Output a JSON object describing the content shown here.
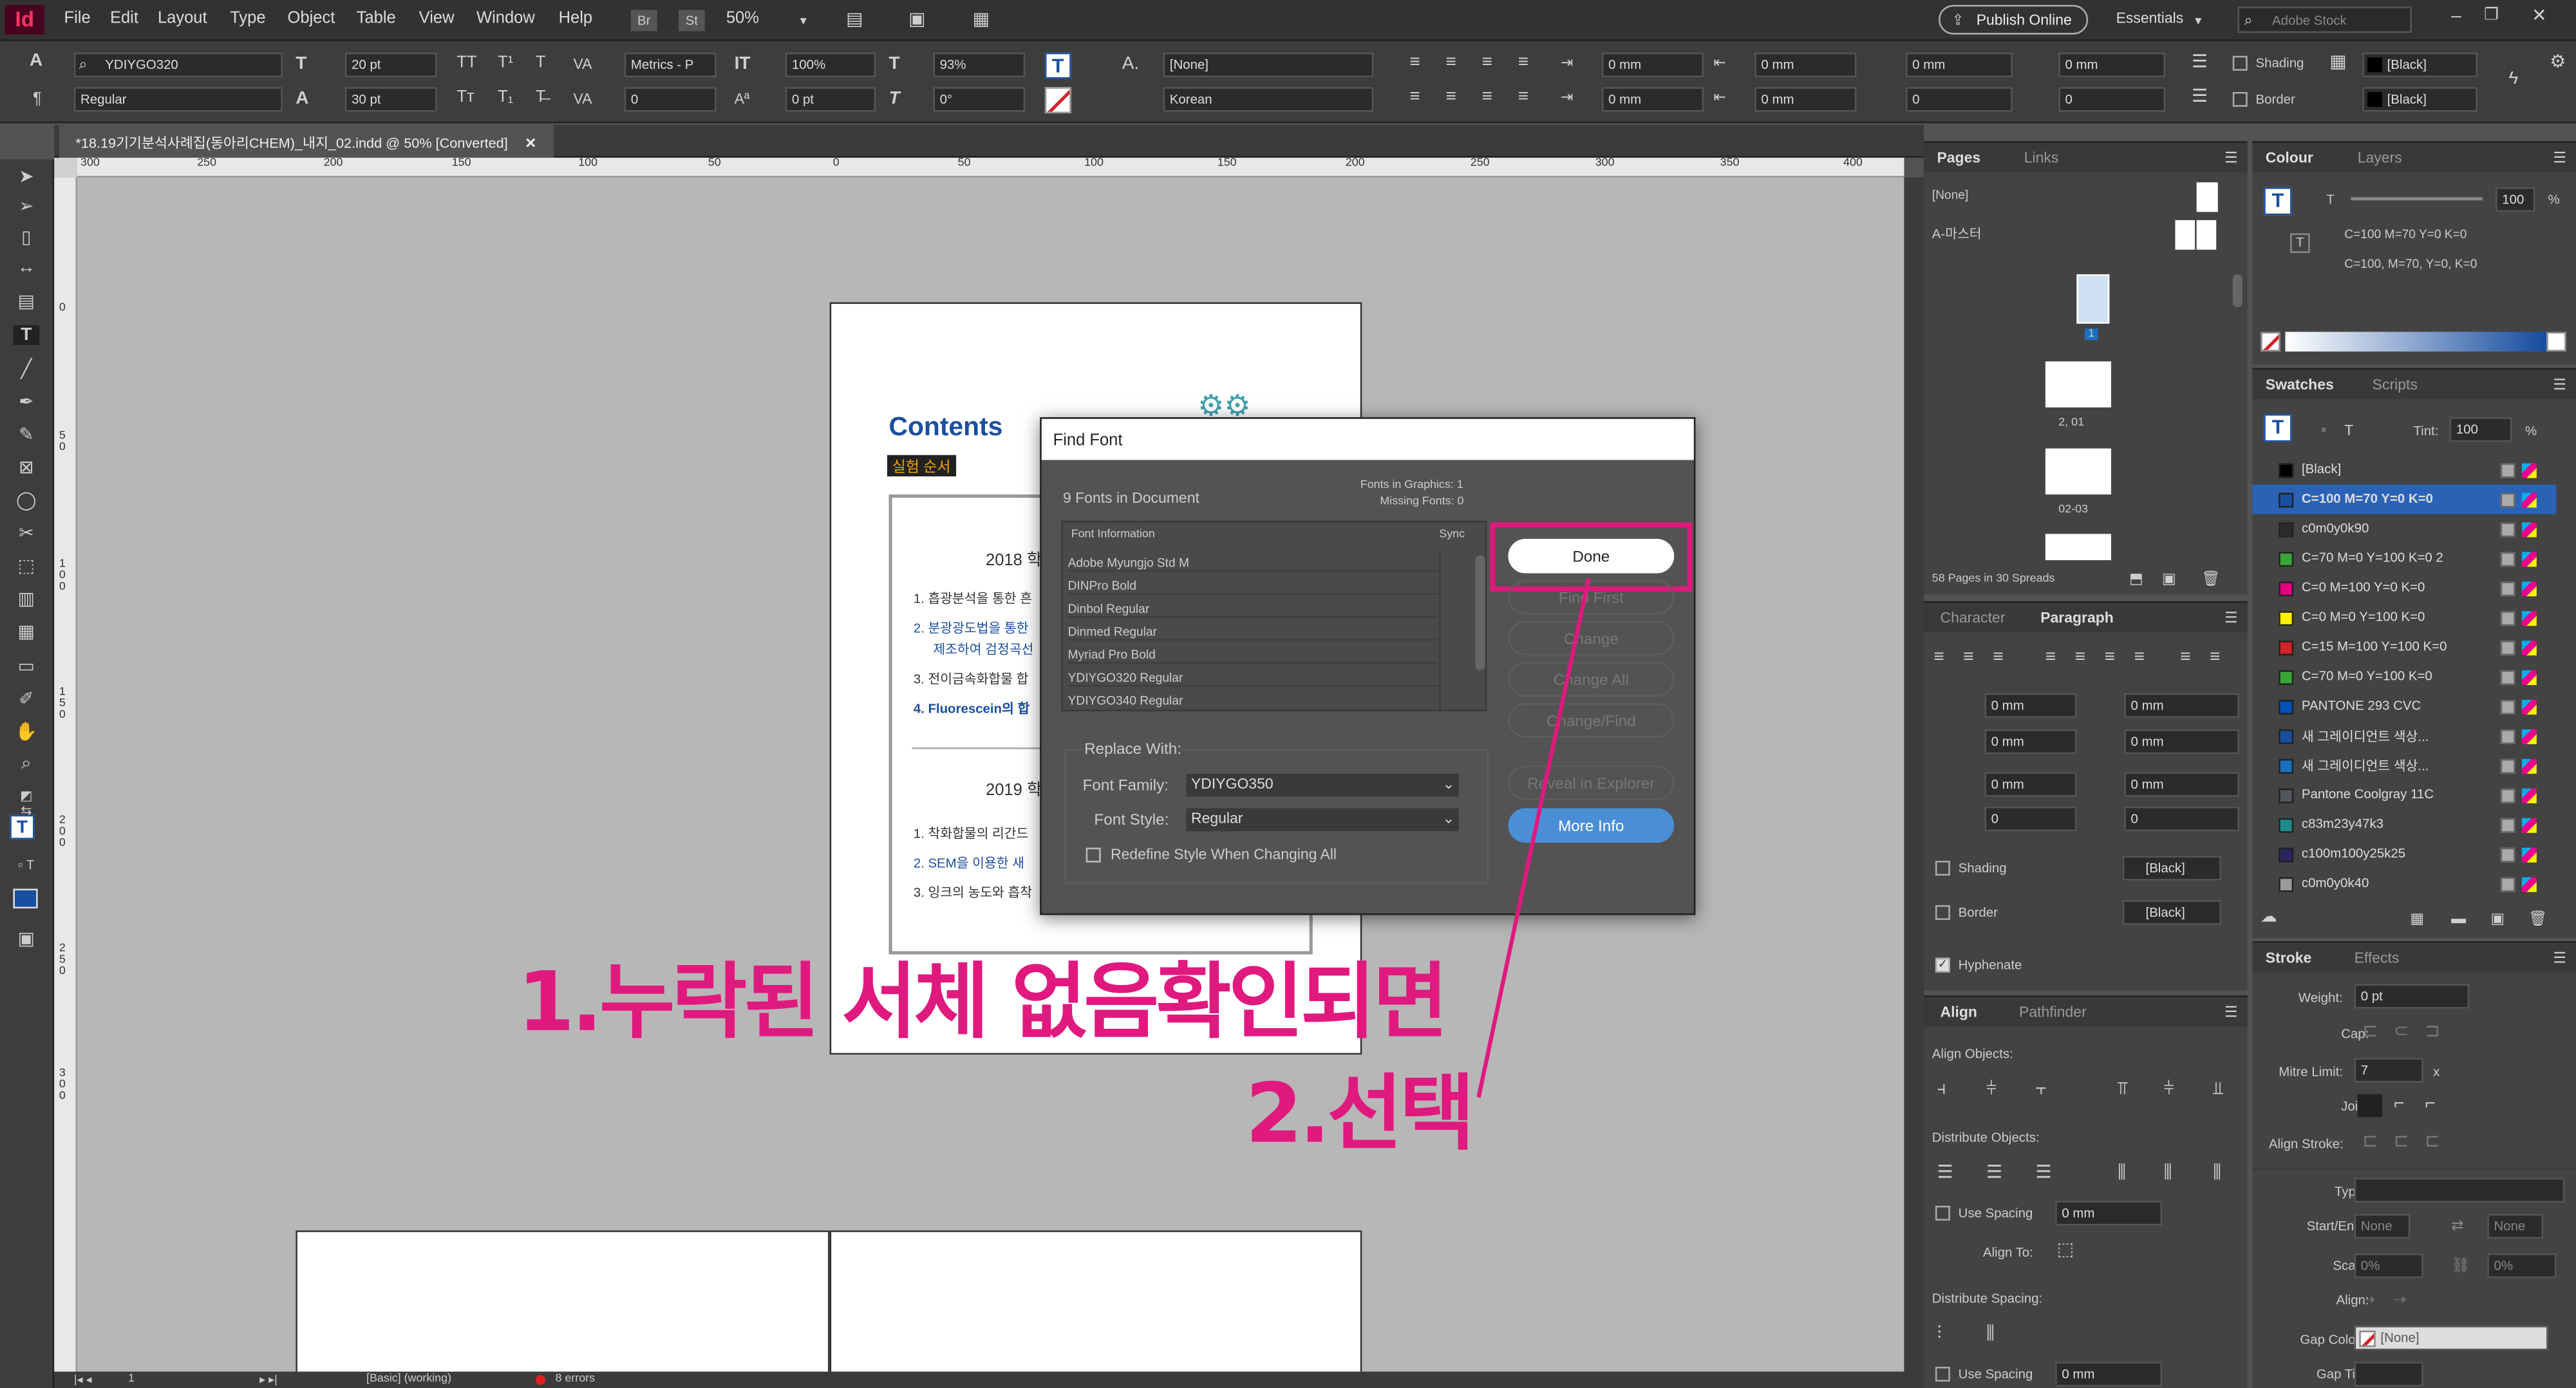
{
  "app": {
    "logo": "Id"
  },
  "menu": [
    "File",
    "Edit",
    "Layout",
    "Type",
    "Object",
    "Table",
    "View",
    "Window",
    "Help"
  ],
  "menubar": {
    "br": "Br",
    "st": "St",
    "zoom": "50%",
    "publish": "Publish Online",
    "workspace": "Essentials",
    "stock_placeholder": "Adobe Stock"
  },
  "control": {
    "font_family": "YDIYGO320",
    "font_style": "Regular",
    "font_size": "20 pt",
    "leading": "30 pt",
    "kerning": "Metrics - P",
    "tracking": "0",
    "vscale": "100%",
    "baseline": "0 pt",
    "hscale": "93%",
    "skew": "0°",
    "char_style": "[None]",
    "language": "Korean",
    "indent_left": "0 mm",
    "indent_first": "0 mm",
    "indent_right": "0 mm",
    "indent_last": "0 mm",
    "space_before": "0 mm",
    "space_after": "0 mm",
    "drop_lines": "0",
    "drop_chars": "0",
    "shading": "Shading",
    "border": "Border",
    "swatch": "[Black]"
  },
  "doc_tab": "*18.19기기분석사례집(동아리CHEM)_내지_02.indd @ 50% [Converted]",
  "ruler_h": [
    "300",
    "250",
    "200",
    "150",
    "100",
    "50",
    "0",
    "50",
    "100",
    "150",
    "200",
    "250",
    "300",
    "350",
    "400"
  ],
  "ruler_v": [
    "0",
    "5\n0",
    "1\n0\n0",
    "1\n5\n0",
    "2\n0\n0",
    "2\n5\n0",
    "3\n0\n0"
  ],
  "page_content": {
    "title": "Contents",
    "tag": "실험 순서",
    "h2018": "2018 학",
    "items2018": [
      "1. 흡광분석을 통한 흔",
      "2. 분광광도법을 통한",
      "제조하여 검정곡선",
      "3. 전이금속화합물 합",
      "4. Fluorescein의 합"
    ],
    "h2019": "2019 학",
    "items2019": [
      "1. 착화합물의 리간드",
      "2. SEM을 이용한 새",
      "3. 잉크의 농도와 흡착"
    ]
  },
  "dialog": {
    "title": "Find Font",
    "fonts_count": "9 Fonts in Document",
    "fonts_in_graphics": "Fonts in Graphics: 1",
    "missing_fonts": "Missing Fonts: 0",
    "col_font": "Font Information",
    "col_sync": "Sync",
    "fonts": [
      "Adobe Myungjo Std M",
      "DINPro Bold",
      "Dinbol Regular",
      "Dinmed Regular",
      "Myriad Pro Bold",
      "YDIYGO320 Regular",
      "YDIYGO340 Regular"
    ],
    "btn_done": "Done",
    "btn_find_first": "Find First",
    "btn_change": "Change",
    "btn_change_all": "Change All",
    "btn_change_find": "Change/Find",
    "btn_reveal": "Reveal in Explorer",
    "btn_more": "More Info",
    "replace_with": "Replace With:",
    "family_label": "Font Family:",
    "family_value": "YDIYGO350",
    "style_label": "Font Style:",
    "style_value": "Regular",
    "redefine": "Redefine Style When Changing All"
  },
  "annotation": {
    "line1": "1.누락된 서체 없음확인되면",
    "line2": "2.선택"
  },
  "status": {
    "page": "1",
    "preflight": "[Basic] (working)",
    "errors": "8 errors"
  },
  "pages_panel": {
    "tab_pages": "Pages",
    "tab_links": "Links",
    "none": "[None]",
    "master": "A-마스터",
    "p1": "1",
    "p2": "2, 01",
    "p3": "02-03",
    "summary": "58 Pages in 30 Spreads"
  },
  "colour_panel": {
    "tab_colour": "Colour",
    "tab_layers": "Layers",
    "t": "T",
    "pct": "100",
    "pct_sign": "%",
    "cmyk1": "C=100 M=70 Y=0 K=0",
    "cmyk2": "C=100, M=70, Y=0, K=0"
  },
  "swatches_panel": {
    "tab_swatches": "Swatches",
    "tab_scripts": "Scripts",
    "tint_label": "Tint:",
    "tint": "100",
    "pct": "%",
    "items": [
      {
        "name": "[Black]",
        "color": "#000000"
      },
      {
        "name": "C=100 M=70 Y=0 K=0",
        "color": "#1a4fa0"
      },
      {
        "name": "c0m0y0k90",
        "color": "#2b2b2b"
      },
      {
        "name": "C=70 M=0 Y=100 K=0 2",
        "color": "#3aa639"
      },
      {
        "name": "C=0 M=100 Y=0 K=0",
        "color": "#e6007e"
      },
      {
        "name": "C=0 M=0 Y=100 K=0",
        "color": "#fff100"
      },
      {
        "name": "C=15 M=100 Y=100 K=0",
        "color": "#d2232a"
      },
      {
        "name": "C=70 M=0 Y=100 K=0",
        "color": "#3aa639"
      },
      {
        "name": "PANTONE 293 CVC",
        "color": "#0051ba"
      },
      {
        "name": "새 그레이디언트 색상...",
        "color": "#1a4fa0"
      },
      {
        "name": "새 그레이디언트 색상...",
        "color": "#1a6fc0"
      },
      {
        "name": "Pantone Coolgray 11C",
        "color": "#53565a"
      },
      {
        "name": "c83m23y47k3",
        "color": "#1e8b8a"
      },
      {
        "name": "c100m100y25k25",
        "color": "#2a2460"
      },
      {
        "name": "c0m0y0k40",
        "color": "#999999"
      }
    ]
  },
  "paragraph_panel": {
    "tab_character": "Character",
    "tab_paragraph": "Paragraph",
    "mm": "0 mm",
    "zero": "0",
    "shading": "Shading",
    "border": "Border",
    "black": "[Black]",
    "hyphenate": "Hyphenate"
  },
  "align_panel": {
    "tab_align": "Align",
    "tab_pathfinder": "Pathfinder",
    "align_objects": "Align Objects:",
    "distribute_objects": "Distribute Objects:",
    "use_spacing": "Use Spacing",
    "mm": "0 mm",
    "align_to": "Align To:",
    "distribute_spacing": "Distribute Spacing:"
  },
  "stroke_panel": {
    "tab_stroke": "Stroke",
    "tab_effects": "Effects",
    "weight": "Weight:",
    "weight_val": "0 pt",
    "cap": "Cap:",
    "mitre": "Mitre Limit:",
    "mitre_val": "7",
    "x": "x",
    "join": "Join:",
    "align_stroke": "Align Stroke:",
    "type": "Type:",
    "start_end": "Start/End:",
    "none": "None",
    "scale": "Scale:",
    "pct": "0%",
    "align": "Align:",
    "gap_colour": "Gap Colour:",
    "gap_none": "[None]",
    "gap_tint": "Gap Tint:"
  }
}
